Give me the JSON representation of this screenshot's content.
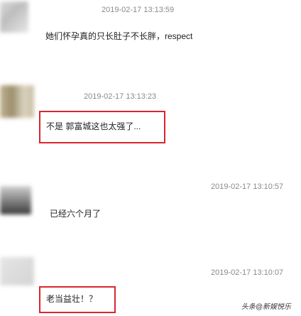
{
  "comments": [
    {
      "time": "2019-02-17 13:13:59",
      "text": "她们怀孕真的只长肚子不长胖，respect"
    },
    {
      "time": "2019-02-17 13:13:23",
      "text": "不是 郭富城这也太强了..."
    },
    {
      "time": "2019-02-17 13:10:57",
      "text": "已经六个月了"
    },
    {
      "time": "2019-02-17 13:10:07",
      "text": "老当益壮！？"
    }
  ],
  "watermark": "头条@新娱悦乐",
  "colors": {
    "highlight_box": "#d9262d",
    "timestamp": "#8a8a8a",
    "text": "#222222"
  }
}
